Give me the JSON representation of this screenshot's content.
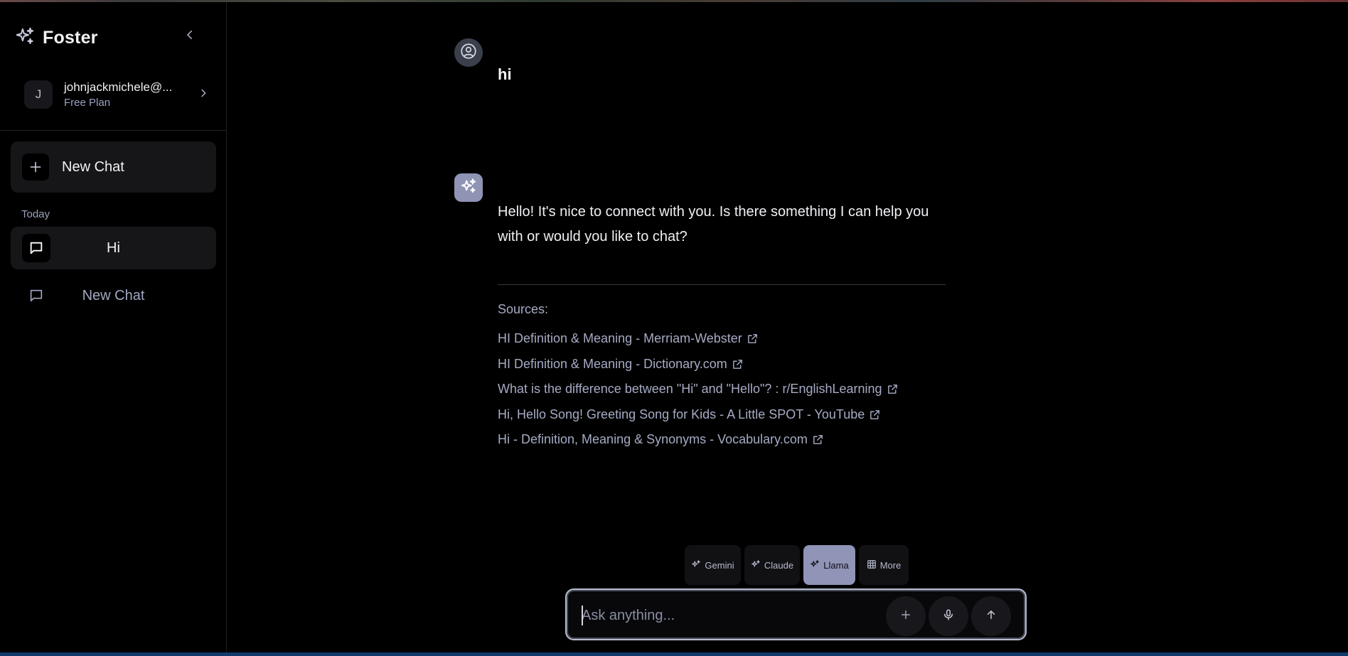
{
  "app": {
    "name": "Foster"
  },
  "account": {
    "initial": "J",
    "email": "johnjackmichele@...",
    "plan": "Free Plan"
  },
  "sidebar": {
    "new_chat_label": "New Chat",
    "section_label": "Today",
    "chats": [
      {
        "label": "Hi",
        "active": true
      },
      {
        "label": "New Chat",
        "active": false
      }
    ]
  },
  "conversation": {
    "user_message": "hi",
    "ai_message": "Hello! It's nice to connect with you. Is there something I can help you with or would you like to chat?",
    "sources_label": "Sources:",
    "sources": [
      "HI Definition & Meaning - Merriam-Webster",
      "HI Definition & Meaning - Dictionary.com",
      "What is the difference between \"Hi\" and \"Hello\"? : r/EnglishLearning",
      "Hi, Hello Song! Greeting Song for Kids - A Little SPOT - YouTube",
      "Hi - Definition, Meaning & Synonyms - Vocabulary.com"
    ]
  },
  "models": [
    {
      "label": "Gemini",
      "icon": "sparkle-icon",
      "active": false
    },
    {
      "label": "Claude",
      "icon": "sparkle-icon",
      "active": false
    },
    {
      "label": "Llama",
      "icon": "sparkle-icon",
      "active": true
    },
    {
      "label": "More",
      "icon": "grid-icon",
      "active": false
    }
  ],
  "composer": {
    "placeholder": "Ask anything..."
  },
  "colors": {
    "accent": "#9094b6",
    "background": "#000000",
    "panel": "#161619",
    "link": "#a6abc4"
  }
}
